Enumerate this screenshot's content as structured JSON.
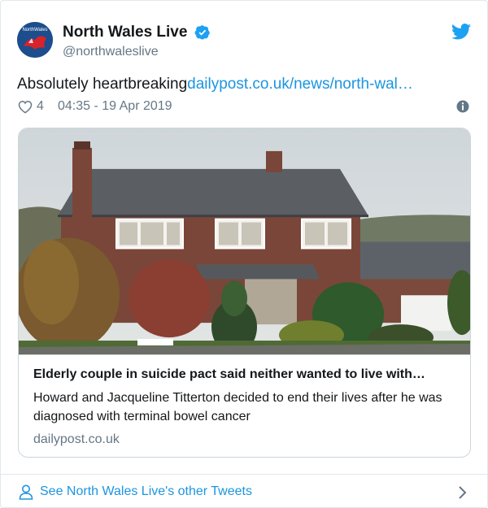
{
  "account": {
    "display_name": "North Wales Live",
    "handle": "@northwaleslive",
    "avatar_text": "NorthWales"
  },
  "tweet": {
    "text": "Absolutely heartbreaking",
    "link": "dailypost.co.uk/news/north-wal…",
    "likes": "4",
    "timestamp": "04:35 - 19 Apr 2019"
  },
  "card": {
    "title": "Elderly couple in suicide pact said neither wanted to live with…",
    "description": "Howard and Jacqueline Titterton decided to end their lives after he was diagnosed with terminal bowel cancer",
    "domain": "dailypost.co.uk"
  },
  "footer": {
    "see_more": "See North Wales Live's other Tweets"
  },
  "icons": [
    "verified-badge-icon",
    "twitter-bird-icon",
    "heart-icon",
    "info-icon",
    "person-icon",
    "chevron-right-icon"
  ],
  "colors": {
    "link_blue": "#1b95e0",
    "text": "#14171a",
    "secondary": "#657786",
    "border": "#ccd6dd"
  }
}
